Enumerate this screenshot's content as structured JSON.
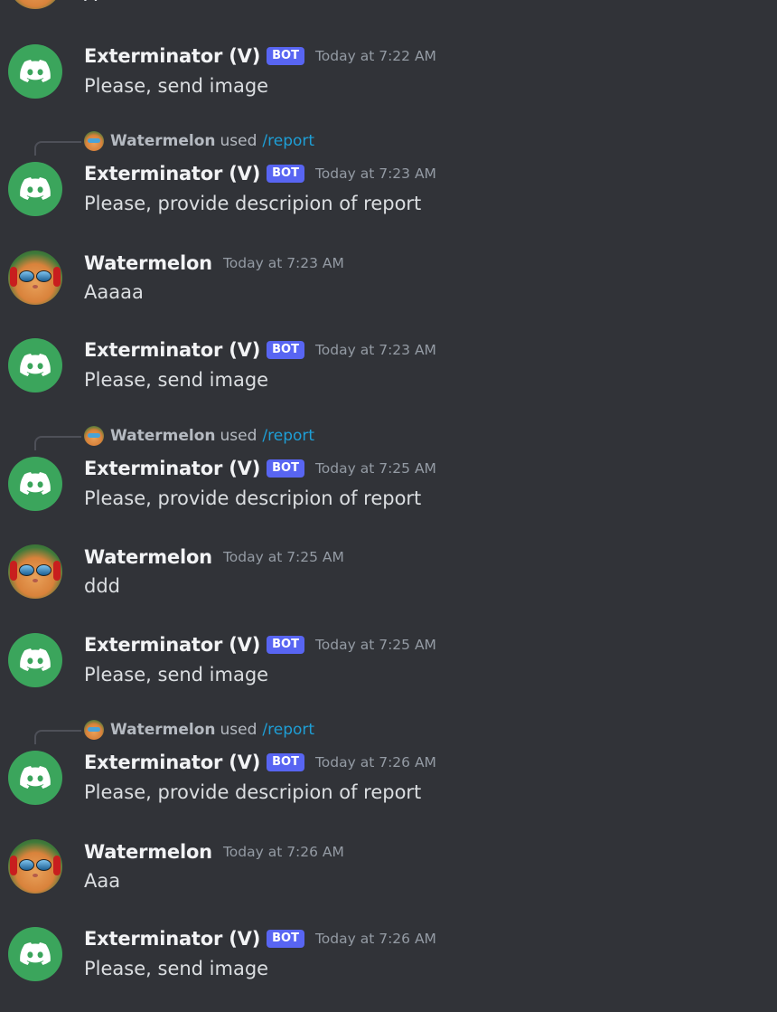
{
  "partial_top": {
    "text": "A"
  },
  "messages": [
    {
      "username": "Exterminator (V)",
      "bot_tag": "BOT",
      "timestamp": "Today at 7:22 AM",
      "content": "Please, send image"
    },
    {
      "reply_user": "Watermelon",
      "reply_used": "used",
      "reply_cmd": "/report",
      "username": "Exterminator (V)",
      "bot_tag": "BOT",
      "timestamp": "Today at 7:23 AM",
      "content": "Please, provide descripion of report"
    },
    {
      "username": "Watermelon",
      "timestamp": "Today at 7:23 AM",
      "content": "Aaaaa"
    },
    {
      "username": "Exterminator (V)",
      "bot_tag": "BOT",
      "timestamp": "Today at 7:23 AM",
      "content": "Please, send image"
    },
    {
      "reply_user": "Watermelon",
      "reply_used": "used",
      "reply_cmd": "/report",
      "username": "Exterminator (V)",
      "bot_tag": "BOT",
      "timestamp": "Today at 7:25 AM",
      "content": "Please, provide descripion of report"
    },
    {
      "username": "Watermelon",
      "timestamp": "Today at 7:25 AM",
      "content": "ddd"
    },
    {
      "username": "Exterminator (V)",
      "bot_tag": "BOT",
      "timestamp": "Today at 7:25 AM",
      "content": "Please, send image"
    },
    {
      "reply_user": "Watermelon",
      "reply_used": "used",
      "reply_cmd": "/report",
      "username": "Exterminator (V)",
      "bot_tag": "BOT",
      "timestamp": "Today at 7:26 AM",
      "content": "Please, provide descripion of report"
    },
    {
      "username": "Watermelon",
      "timestamp": "Today at 7:26 AM",
      "content": "Aaa"
    },
    {
      "username": "Exterminator (V)",
      "bot_tag": "BOT",
      "timestamp": "Today at 7:26 AM",
      "content": "Please, send image"
    }
  ],
  "colors": {
    "background": "#313338",
    "bot_avatar": "#3ba55c",
    "bot_tag": "#5865f2",
    "command_link": "#1e9fd6",
    "timestamp": "#949ba4"
  }
}
